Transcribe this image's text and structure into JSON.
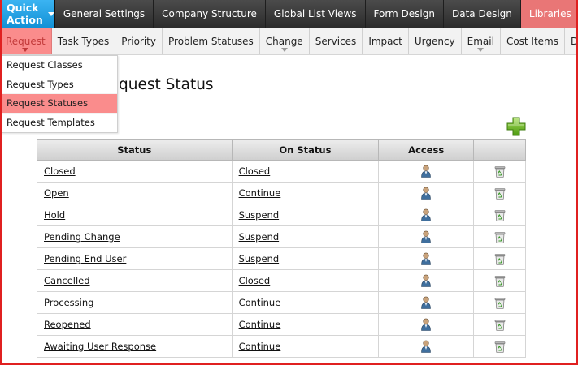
{
  "topnav": {
    "quick_action": "Quick Action",
    "items": [
      {
        "label": "General Settings"
      },
      {
        "label": "Company Structure"
      },
      {
        "label": "Global List Views"
      },
      {
        "label": "Form Design"
      },
      {
        "label": "Data Design"
      },
      {
        "label": "Libraries"
      }
    ]
  },
  "subnav": {
    "items": [
      {
        "label": "Request"
      },
      {
        "label": "Task Types"
      },
      {
        "label": "Priority"
      },
      {
        "label": "Problem Statuses"
      },
      {
        "label": "Change"
      },
      {
        "label": "Services"
      },
      {
        "label": "Impact"
      },
      {
        "label": "Urgency"
      },
      {
        "label": "Email"
      },
      {
        "label": "Cost Items"
      },
      {
        "label": "Drop"
      }
    ]
  },
  "dropdown": {
    "items": [
      {
        "label": "Request Classes"
      },
      {
        "label": "Request Types"
      },
      {
        "label": "Request Statuses"
      },
      {
        "label": "Request Templates"
      }
    ]
  },
  "page": {
    "title": "quest Status"
  },
  "table": {
    "headers": {
      "status": "Status",
      "on_status": "On Status",
      "access": "Access",
      "delete": ""
    },
    "rows": [
      {
        "status": "Closed",
        "on_status": "Closed"
      },
      {
        "status": "Open",
        "on_status": "Continue"
      },
      {
        "status": "Hold",
        "on_status": "Suspend"
      },
      {
        "status": "Pending Change",
        "on_status": "Suspend"
      },
      {
        "status": "Pending End User",
        "on_status": "Suspend"
      },
      {
        "status": "Cancelled",
        "on_status": "Closed"
      },
      {
        "status": "Processing",
        "on_status": "Continue"
      },
      {
        "status": "Reopened",
        "on_status": "Continue"
      },
      {
        "status": "Awaiting User Response",
        "on_status": "Continue"
      }
    ]
  },
  "icons": {
    "add": "plus-icon",
    "access": "user-icon",
    "delete": "recycle-bin-icon"
  },
  "colors": {
    "quick_action_bg": "#1e9fe3",
    "topnav_bg": "#3a3a3a",
    "active_tab": "#fa8c8c",
    "frame_border": "#e02020"
  }
}
